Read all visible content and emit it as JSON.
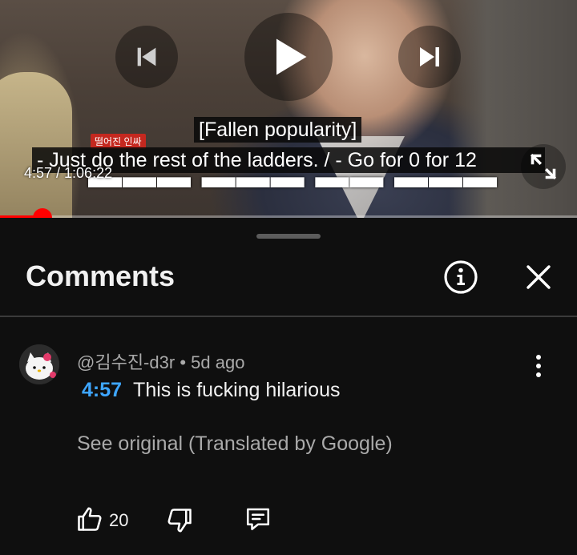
{
  "video": {
    "caption_line1": "[Fallen popularity]",
    "caption_line2": "- Just do the rest of the ladders. / - Go for 0 for 12",
    "time_display": "4:57 / 1:06:22",
    "burned_chip": "떨어진 인싸",
    "progress_fraction": 0.0746,
    "controls": {
      "previous": "skip-previous-icon",
      "play": "play-icon",
      "next": "skip-next-icon",
      "fullscreen": "fullscreen-icon"
    }
  },
  "comments_panel": {
    "title": "Comments",
    "info_icon": "info-icon",
    "close_icon": "close-icon"
  },
  "comments": [
    {
      "author": "@김수진-d3r",
      "separator": "•",
      "age": "5d ago",
      "timestamp": "4:57",
      "text": "This is fucking hilarious",
      "see_original": "See original (Translated by Google)",
      "likes": "20"
    }
  ],
  "colors": {
    "accent_progress": "#ff0000",
    "timestamp_link": "#3ea6ff",
    "background": "#0f0f0f",
    "secondary_text": "#aaaaaa"
  }
}
